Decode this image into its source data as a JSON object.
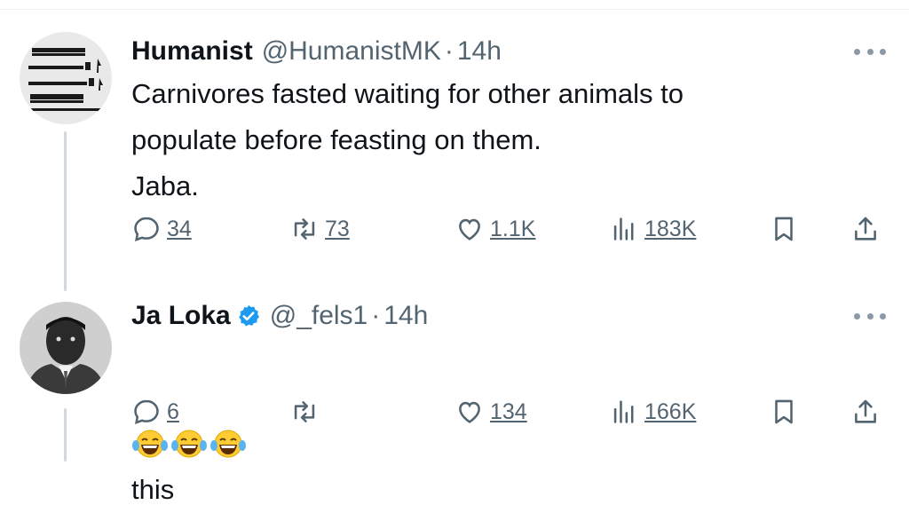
{
  "tweets": [
    {
      "name": "Humanist",
      "handle": "@HumanistMK",
      "separator": "·",
      "time": "14h",
      "text": "Carnivores fasted waiting for other animals to\npopulate before feasting on them.\nJaba.",
      "verified": false,
      "avatar_icon": "population-chart-avatar",
      "metrics": {
        "replies": "34",
        "retweets": "73",
        "likes": "1.1K",
        "views": "183K"
      }
    },
    {
      "name": "Ja Loka",
      "handle": "@_fels1",
      "separator": "·",
      "time": "14h",
      "text": "this",
      "emojis": [
        "😂",
        "😂",
        "😂"
      ],
      "verified": true,
      "avatar_icon": "man-portrait-avatar",
      "metrics": {
        "replies": "6",
        "retweets": "",
        "likes": "134",
        "views": "166K"
      }
    }
  ],
  "colors": {
    "text": "#0f1419",
    "secondary": "#536471",
    "verified": "#1d9bf0",
    "thread_line": "#cfd9de"
  },
  "icons": [
    "reply-icon",
    "retweet-icon",
    "like-icon",
    "views-icon",
    "bookmark-icon",
    "share-icon",
    "more-icon",
    "verified-icon"
  ]
}
